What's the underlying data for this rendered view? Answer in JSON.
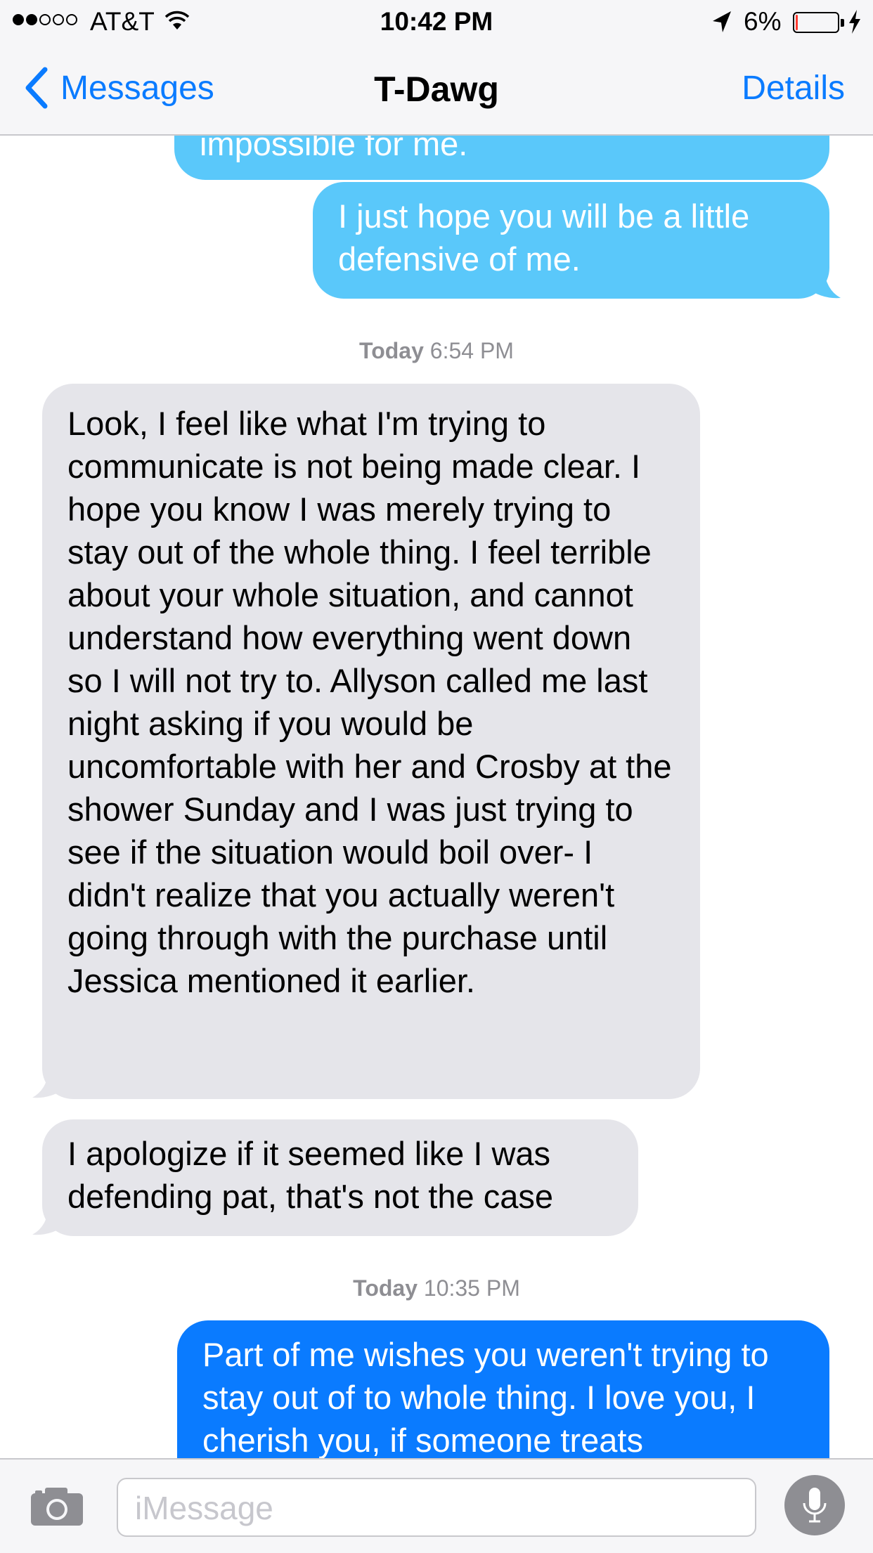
{
  "status_bar": {
    "carrier": "AT&T",
    "time": "10:42 PM",
    "battery_percent": "6%",
    "battery_level": 0.06,
    "signal_bars_filled": 2,
    "signal_bars_total": 5
  },
  "nav": {
    "back_label": "Messages",
    "title": "T-Dawg",
    "details_label": "Details"
  },
  "messages": [
    {
      "from": "me",
      "text": "impossible for me."
    },
    {
      "from": "me",
      "text": "I just hope you will be a little defensive of me."
    },
    {
      "from": "them",
      "text": "Look, I feel like what I'm trying to communicate is not being made clear. I hope you know I was merely trying to stay out of the whole thing. I feel terrible about your whole situation, and cannot understand how everything went down so I will not try to. Allyson called me last night asking if you would be uncomfortable with her and Crosby at the shower Sunday and I was just trying to see if the situation would boil over- I didn't realize that you actually weren't going through with the purchase until Jessica mentioned it earlier."
    },
    {
      "from": "them",
      "text": "I apologize if it seemed like I was defending pat, that's not the case"
    },
    {
      "from": "me",
      "text": "Part of me wishes you weren't trying to stay out of to whole thing. I love you, I cherish you, if someone treats"
    }
  ],
  "timestamps": [
    {
      "day": "Today",
      "time": "6:54 PM"
    },
    {
      "day": "Today",
      "time": "10:35 PM"
    }
  ],
  "input": {
    "placeholder": "iMessage"
  },
  "colors": {
    "ios_blue": "#0a7bff",
    "sent_light": "#5ac8fa",
    "received_gray": "#e5e5ea",
    "battery_low": "#ff3b30"
  },
  "icons": [
    "wifi-icon",
    "location-arrow-icon",
    "battery-icon",
    "charging-bolt-icon",
    "back-chevron-icon",
    "camera-icon",
    "microphone-icon"
  ]
}
